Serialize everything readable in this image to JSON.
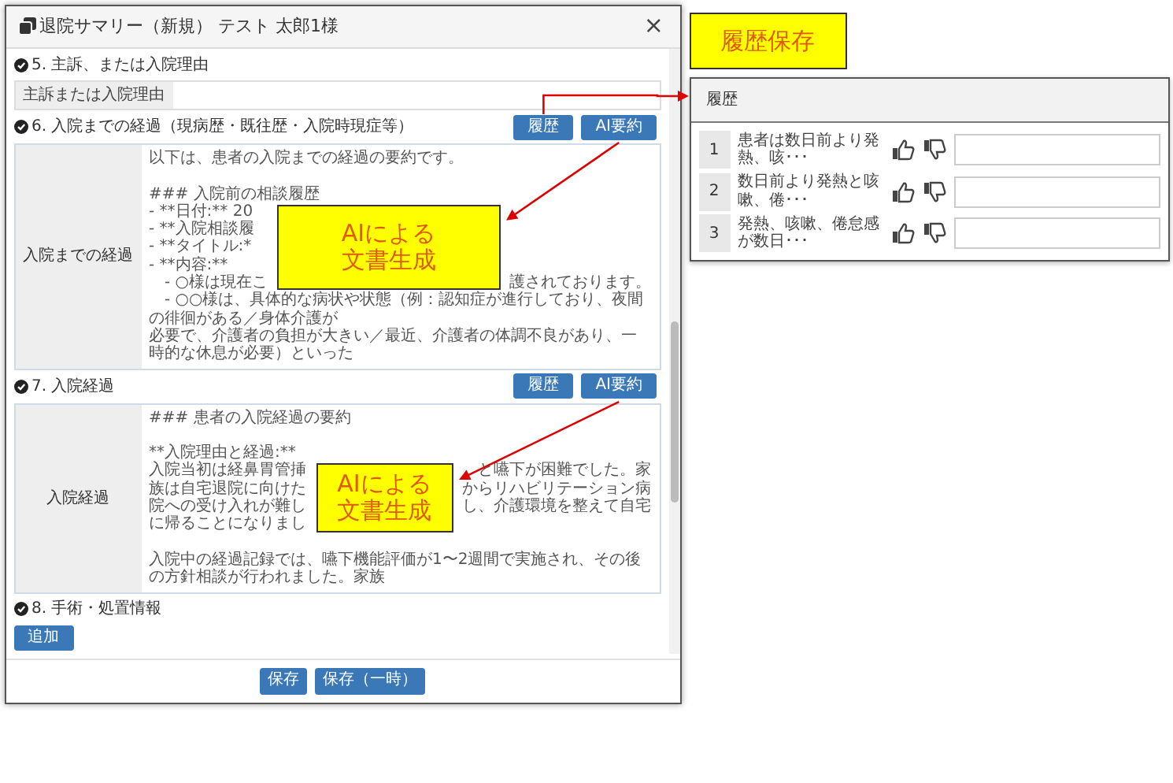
{
  "dialog": {
    "title": "退院サマリー（新規） テスト 太郎1様",
    "close": "×",
    "sections": [
      {
        "kind": "input",
        "label": "5. 主訴、または入院理由",
        "addon": "主訴または入院理由"
      },
      {
        "kind": "textarea",
        "label": "6. 入院までの経過（現病歴・既往歴・入院時現症等）",
        "buttons": [
          "履歴",
          "AI要約"
        ],
        "addon": "入院までの経過",
        "paragraphs": [
          [
            "以下は、患者の入院までの経過の要約です。"
          ],
          [
            "### 入院前の相談履歴",
            {
              "left": "- **日付:** 20"
            },
            {
              "left": "- **入院相談履"
            },
            {
              "left": "- **タイトル:*"
            },
            {
              "left": "- **内容:**"
            },
            {
              "left": "　- ○様は現在こ",
              "right": "護されております。"
            },
            "　- ○○様は、具体的な病状や状態（例：認知症が進行しており、夜間の徘徊がある／身体介護が",
            "必要で、介護者の負担が大きい／最近、介護者の体調不良があり、一時的な休息が必要）といった"
          ]
        ],
        "callout": [
          "AIによる",
          "文書生成"
        ]
      },
      {
        "kind": "textarea",
        "label": "7. 入院経過",
        "buttons": [
          "履歴",
          "AI要約"
        ],
        "addon": "入院経過",
        "paragraphs": [
          [
            "### 患者の入院経過の要約"
          ],
          [
            "**入院理由と経過:**",
            {
              "left": "入院当初は経鼻胃管挿",
              "right": "と嚥下が困難でした。家"
            },
            {
              "left": "族は自宅退院に向けた",
              "right": "からリハビリテーション病"
            },
            {
              "left": "院への受け入れが難し",
              "right": "し、介護環境を整えて自宅"
            },
            {
              "left": "に帰ることになりまし"
            }
          ],
          [
            "入院中の経過記録では、嚥下機能評価が1〜2週間で実施され、その後の方針相談が行われました。家族"
          ]
        ],
        "callout": [
          "AIによる",
          "文書生成"
        ]
      },
      {
        "kind": "add",
        "label": "8. 手術・処置情報",
        "button": "追加"
      }
    ],
    "footer_buttons": [
      "保存",
      "保存（一時）"
    ]
  },
  "history_label": "履歴保存",
  "history_panel": {
    "title": "履歴",
    "rows": [
      {
        "number": "1",
        "text": "患者は数日前より発熱、咳･･･"
      },
      {
        "number": "2",
        "text": "数日前より発熱と咳嗽、倦･･･"
      },
      {
        "number": "3",
        "text": "発熱、咳嗽、倦怠感が数日･･･"
      }
    ]
  }
}
